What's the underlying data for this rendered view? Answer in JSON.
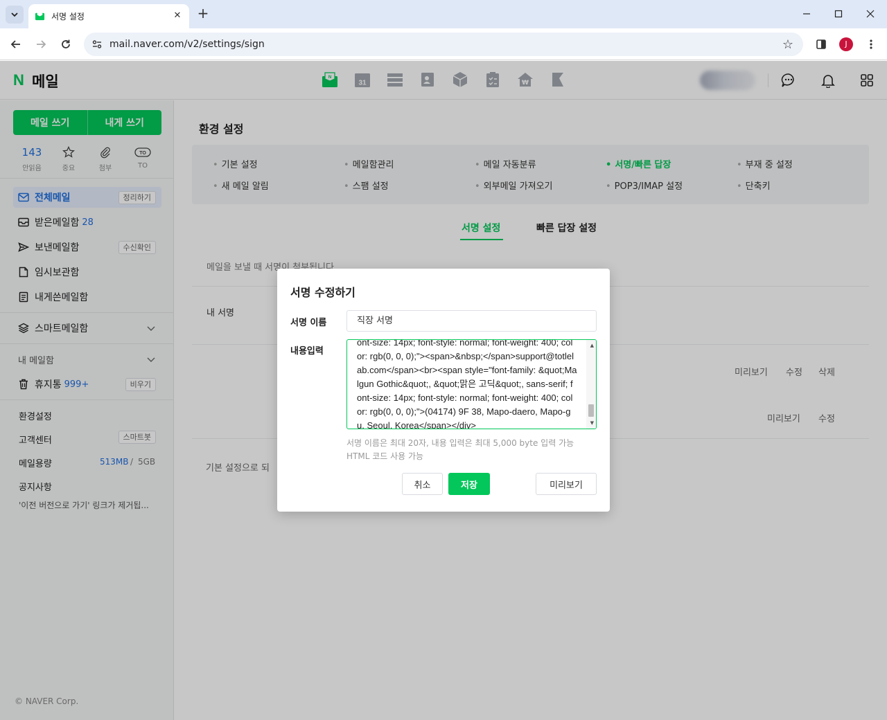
{
  "browser": {
    "tab_title": "서명 설정",
    "url": "mail.naver.com/v2/settings/sign",
    "profile_initial": "J"
  },
  "header": {
    "logo_n": "N",
    "logo_text": "메일",
    "calendar_day": "31"
  },
  "sidebar": {
    "write_mail": "메일 쓰기",
    "write_self": "내게 쓰기",
    "quick": [
      {
        "value": "143",
        "label": "안읽음"
      },
      {
        "label": "중요"
      },
      {
        "label": "첨부"
      },
      {
        "label": "TO"
      }
    ],
    "folders": [
      {
        "label": "전체메일",
        "badge": "정리하기"
      },
      {
        "label": "받은메일함",
        "count": "28"
      },
      {
        "label": "보낸메일함",
        "badge": "수신확인"
      },
      {
        "label": "임시보관함"
      },
      {
        "label": "내게쓴메일함"
      }
    ],
    "smart_mailbox": "스마트메일함",
    "my_mailbox": "내 메일함",
    "trash": {
      "label": "휴지통",
      "count": "999+",
      "badge": "비우기"
    },
    "settings": "환경설정",
    "customer_center": {
      "label": "고객센터",
      "badge": "스마트봇"
    },
    "storage": {
      "label": "메일용량",
      "used": "513MB",
      "sep": "/",
      "total": "5GB"
    },
    "notice": {
      "label": "공지사항",
      "text": "'이전 버전으로 가기' 링크가 제거됩..."
    },
    "copyright": "© NAVER Corp."
  },
  "main": {
    "title": "환경 설정",
    "menu": [
      "기본 설정",
      "메일함관리",
      "메일 자동분류",
      "서명/빠른 답장",
      "부재 중 설정",
      "새 메일 알림",
      "스팸 설정",
      "외부메일 가져오기",
      "POP3/IMAP 설정",
      "단축키"
    ],
    "subtabs": [
      "서명 설정",
      "빠른 답장 설정"
    ],
    "description": "메일을 보낼 때 서명이 첨부됩니다",
    "my_signature": "내 서명",
    "row1_actions": [
      "미리보기",
      "수정",
      "삭제"
    ],
    "row2_actions": [
      "미리보기",
      "수정"
    ],
    "reset_text": "기본 설정으로 되"
  },
  "modal": {
    "title": "서명 수정하기",
    "name_label": "서명 이름",
    "name_value": "직장 서명",
    "content_label": "내용입력",
    "content_value": "ont-size: 14px; font-style: normal; font-weight: 400; color: rgb(0, 0, 0);\"><span>&nbsp;</span>support@totlelab.com</span><br><span style=\"font-family: &quot;Malgun Gothic&quot;, &quot;맑은 고딕&quot;, sans-serif; font-size: 14px; font-style: normal; font-weight: 400; color: rgb(0, 0, 0);\">(04174) 9F 38, Mapo-daero, Mapo-gu, Seoul, Korea</span></div>",
    "help_line1": "서명 이름은 최대 20자, 내용 입력은 최대 5,000 byte 입력 가능",
    "help_line2": "HTML 코드 사용 가능",
    "cancel": "취소",
    "save": "저장",
    "preview": "미리보기"
  },
  "colors": {
    "brand": "#03c75a",
    "link": "#1f6fde"
  }
}
